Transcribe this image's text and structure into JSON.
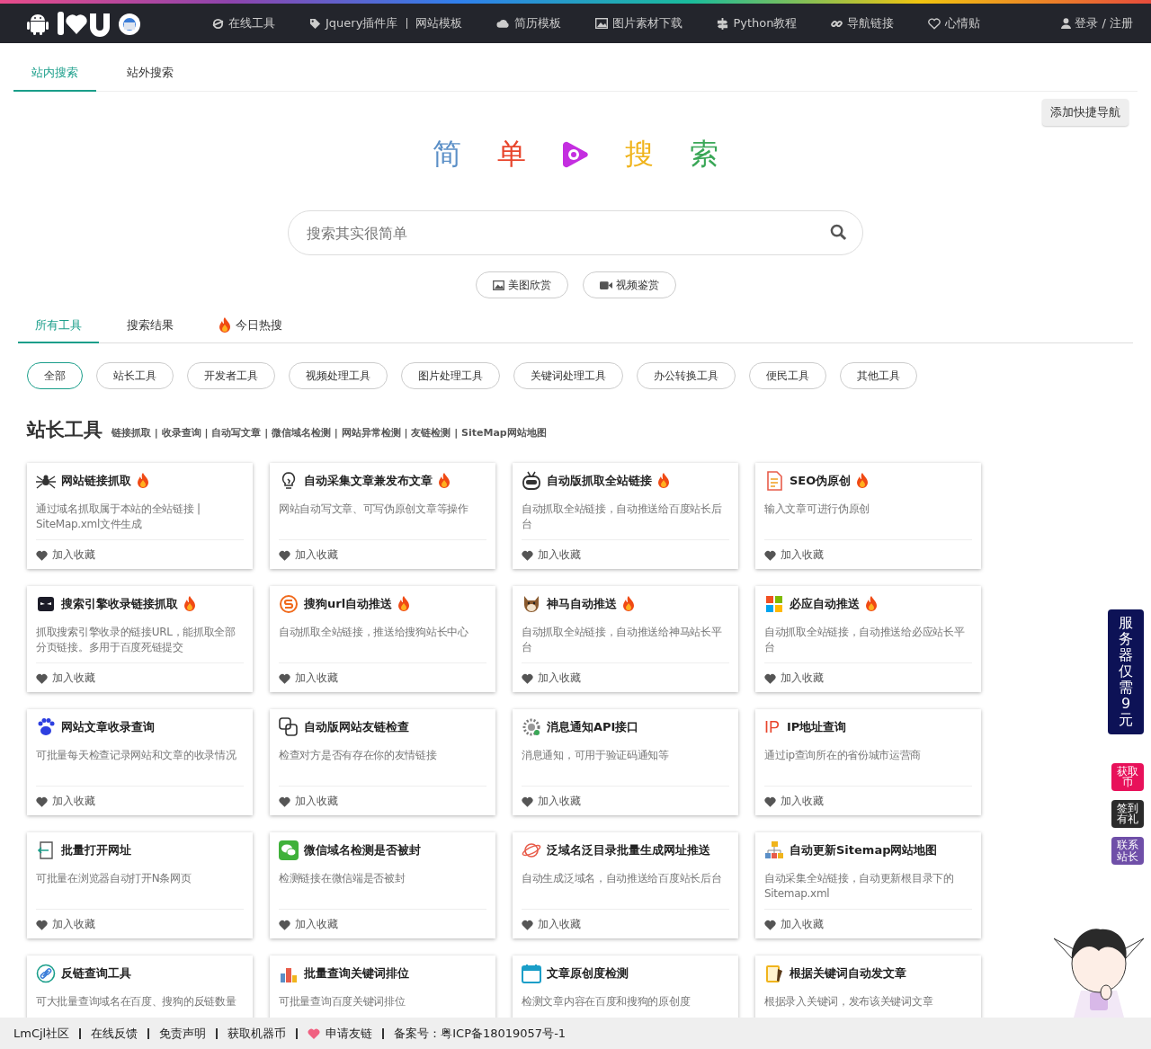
{
  "header": {
    "nav": [
      {
        "label": "在线工具"
      },
      {
        "label": "Jquery插件库"
      },
      {
        "label": "网站模板"
      },
      {
        "label": "简历模板"
      },
      {
        "label": "图片素材下载"
      },
      {
        "label": "Python教程"
      },
      {
        "label": "导航链接"
      },
      {
        "label": "心情贴"
      }
    ],
    "login": "登录 / 注册"
  },
  "search_tabs": [
    {
      "label": "站内搜索",
      "selected": true
    },
    {
      "label": "站外搜索",
      "selected": false
    }
  ],
  "shortcut_button": "添加快捷导航",
  "hero_title": [
    {
      "char": "简",
      "color": "#5b8fc7"
    },
    {
      "char": "单",
      "color": "#e8452c"
    },
    {
      "char": "搜",
      "color": "#f0b41c"
    },
    {
      "char": "索",
      "color": "#3aa757"
    }
  ],
  "search": {
    "placeholder": "搜索其实很简单"
  },
  "quick_links": [
    {
      "label": "美图欣赏"
    },
    {
      "label": "视频鉴赏"
    }
  ],
  "tool_tabs": [
    {
      "label": "所有工具",
      "selected": true,
      "hot": false
    },
    {
      "label": "搜索结果",
      "selected": false,
      "hot": false
    },
    {
      "label": "今日热搜",
      "selected": false,
      "hot": true
    }
  ],
  "filters": [
    {
      "label": "全部",
      "selected": true
    },
    {
      "label": "站长工具",
      "selected": false
    },
    {
      "label": "开发者工具",
      "selected": false
    },
    {
      "label": "视频处理工具",
      "selected": false
    },
    {
      "label": "图片处理工具",
      "selected": false
    },
    {
      "label": "关键词处理工具",
      "selected": false
    },
    {
      "label": "办公转换工具",
      "selected": false
    },
    {
      "label": "便民工具",
      "selected": false
    },
    {
      "label": "其他工具",
      "selected": false
    }
  ],
  "section": {
    "title": "站长工具",
    "subtitle": "链接抓取 | 收录查询 | 自动写文章 | 微信域名检测 | 网站异常检测 | 友链检测 | SiteMap网站地图"
  },
  "cards": [
    {
      "title": "网站链接抓取",
      "hot": true,
      "desc": "通过域名抓取属于本站的全站链接 | SiteMap.xml文件生成",
      "action": "加入收藏"
    },
    {
      "title": "自动采集文章兼发布文章",
      "hot": true,
      "desc": "网站自动写文章、可写伪原创文章等操作",
      "action": "加入收藏"
    },
    {
      "title": "自动版抓取全站链接",
      "hot": true,
      "desc": "自动抓取全站链接，自动推送给百度站长后台",
      "action": "加入收藏"
    },
    {
      "title": "SEO伪原创",
      "hot": true,
      "desc": "输入文章可进行伪原创",
      "action": "加入收藏"
    },
    {
      "title": "搜索引擎收录链接抓取",
      "hot": true,
      "desc": "抓取搜索引擎收录的链接URL，能抓取全部分页链接。多用于百度死链提交",
      "action": "加入收藏"
    },
    {
      "title": "搜狗url自动推送",
      "hot": true,
      "desc": "自动抓取全站链接，推送给搜狗站长中心",
      "action": "加入收藏"
    },
    {
      "title": "神马自动推送",
      "hot": true,
      "desc": "自动抓取全站链接，自动推送给神马站长平台",
      "action": "加入收藏"
    },
    {
      "title": "必应自动推送",
      "hot": true,
      "desc": "自动抓取全站链接，自动推送给必应站长平台",
      "action": "加入收藏"
    },
    {
      "title": "网站文章收录查询",
      "hot": false,
      "desc": "可批量每天检查记录网站和文章的收录情况",
      "action": "加入收藏"
    },
    {
      "title": "自动版网站友链检查",
      "hot": false,
      "desc": "检查对方是否有存在你的友情链接",
      "action": "加入收藏"
    },
    {
      "title": "消息通知API接口",
      "hot": false,
      "desc": "消息通知，可用于验证码通知等",
      "action": "加入收藏"
    },
    {
      "title": "IP地址查询",
      "hot": false,
      "icon_text": "IP",
      "desc": "通过ip查询所在的省份城市运营商",
      "action": "加入收藏"
    },
    {
      "title": "批量打开网址",
      "hot": false,
      "desc": "可批量在浏览器自动打开N条网页",
      "action": "加入收藏"
    },
    {
      "title": "微信域名检测是否被封",
      "hot": false,
      "desc": "检测链接在微信端是否被封",
      "action": "加入收藏"
    },
    {
      "title": "泛域名泛目录批量生成网址推送",
      "hot": false,
      "desc": "自动生成泛域名，自动推送给百度站长后台",
      "action": "加入收藏"
    },
    {
      "title": "自动更新Sitemap网站地图",
      "hot": false,
      "desc": "自动采集全站链接，自动更新根目录下的Sitemap.xml",
      "action": "加入收藏"
    },
    {
      "title": "反链查询工具",
      "hot": false,
      "desc": "可大批量查询域名在百度、搜狗的反链数量"
    },
    {
      "title": "批量查询关键词排位",
      "hot": false,
      "desc": "可批量查询百度关键词排位"
    },
    {
      "title": "文章原创度检测",
      "hot": false,
      "desc": "检测文章内容在百度和搜狗的原创度"
    },
    {
      "title": "根据关键词自动发文章",
      "hot": false,
      "desc": "根据录入关键词，发布该关键词文章"
    }
  ],
  "side_buttons": [
    {
      "lines": [
        "服",
        "务",
        "器",
        "仅",
        "需",
        "9",
        "元"
      ],
      "color": "#0d1256"
    },
    {
      "lines": [
        "获取",
        "币"
      ],
      "color": "#e8115a"
    },
    {
      "lines": [
        "签到",
        "有礼"
      ],
      "color": "#2b2b2b"
    },
    {
      "lines": [
        "联系",
        "站长"
      ],
      "color": "#6f4fa8"
    }
  ],
  "footer": [
    {
      "label": "LmCjl社区",
      "kind": "link"
    },
    {
      "label": "在线反馈",
      "kind": "link"
    },
    {
      "label": "免责声明",
      "kind": "link"
    },
    {
      "label": "获取机器币",
      "kind": "link"
    },
    {
      "label": "申请友链",
      "kind": "heart-link"
    },
    {
      "label": "备案号：粤ICP备18019057号-1",
      "kind": "text"
    }
  ]
}
